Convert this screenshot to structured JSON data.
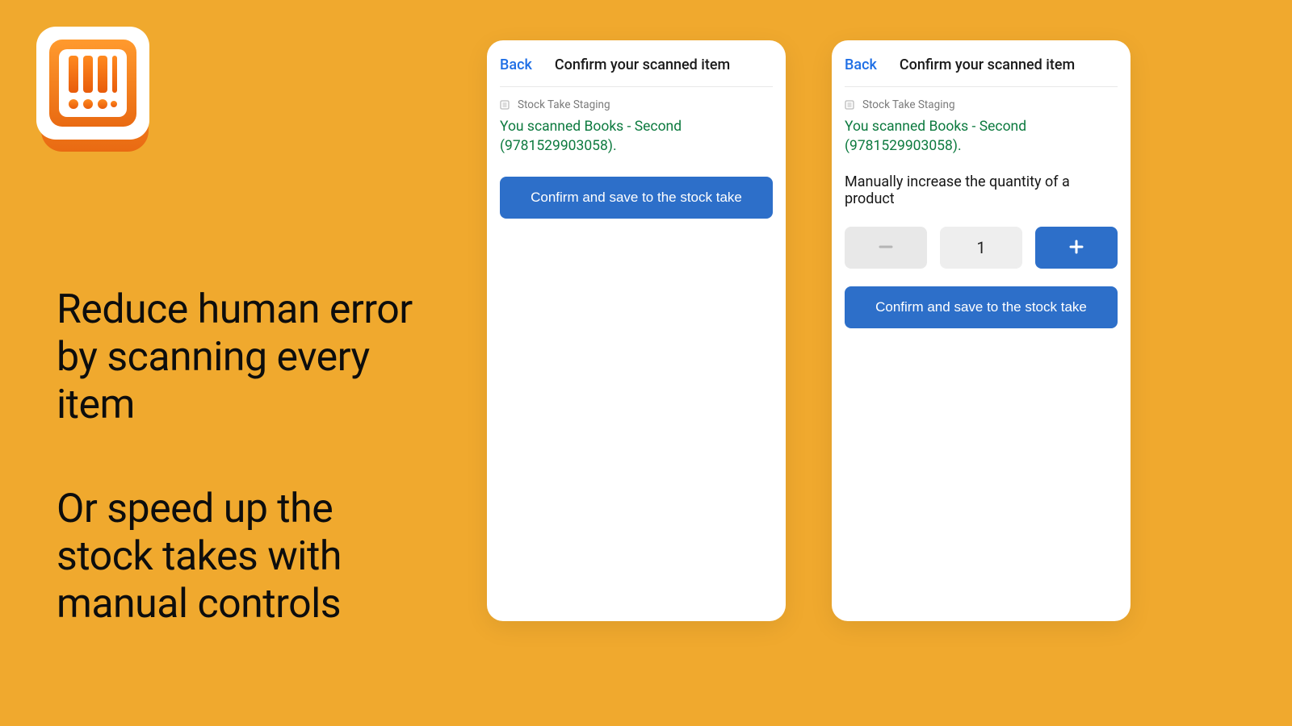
{
  "marketing": {
    "line1": "Reduce human error by scanning every item",
    "line2": "Or speed up the stock takes with manual controls"
  },
  "card1": {
    "back": "Back",
    "title": "Confirm your scanned item",
    "breadcrumb": "Stock Take Staging",
    "scanned": "You scanned Books - Second (9781529903058).",
    "confirm": "Confirm and save to the stock take"
  },
  "card2": {
    "back": "Back",
    "title": "Confirm your scanned item",
    "breadcrumb": "Stock Take Staging",
    "scanned": "You scanned Books - Second (9781529903058).",
    "manual_label": "Manually increase the quantity of a product",
    "quantity": "1",
    "confirm": "Confirm and save to the stock take"
  }
}
